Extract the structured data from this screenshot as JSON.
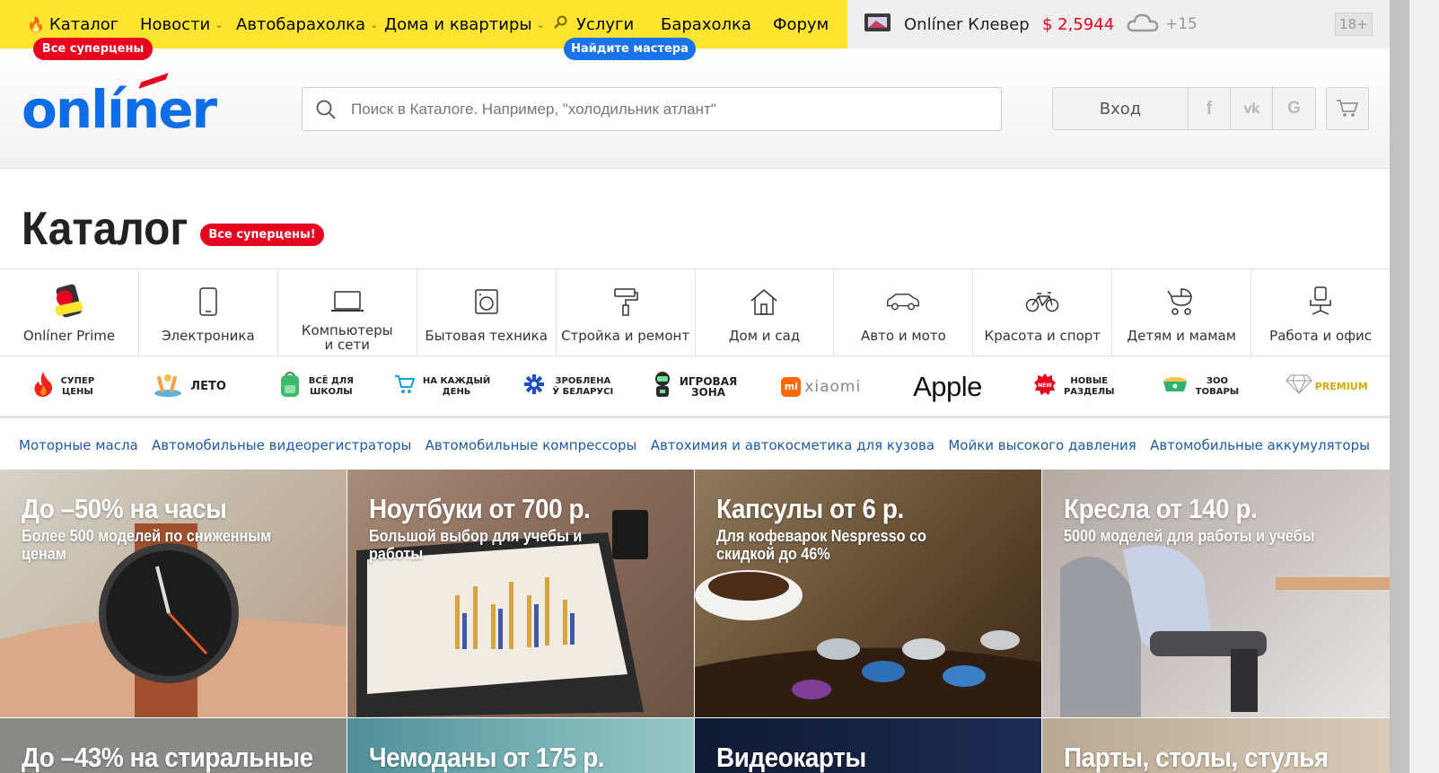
{
  "topnav": {
    "items": [
      {
        "label": "Каталог",
        "icon": "fire-icon"
      },
      {
        "label": "Новости"
      },
      {
        "label": "Автобарахолка"
      },
      {
        "label": "Дома и квартиры"
      },
      {
        "label": "Услуги",
        "icon": "magnifier-icon"
      },
      {
        "label": "Барахолка"
      },
      {
        "label": "Форум"
      }
    ],
    "badge_catalog": "Все суперцены",
    "badge_services": "Найдите мастера",
    "clever": "Onlíner Клевер",
    "rate": "$ 2,5944",
    "temperature": "+15",
    "age": "18+",
    "colors": {
      "yellow": "#ffe52f",
      "red": "#e8001f",
      "blue": "#1a73e8"
    }
  },
  "header": {
    "logo": "onlíner",
    "search_placeholder": "Поиск в Каталоге. Например, \"холодильник атлант\"",
    "login": "Вход",
    "social": [
      "f",
      "vk",
      "G"
    ]
  },
  "catalog": {
    "title": "Каталог",
    "badge": "Все суперцены!",
    "categories": [
      {
        "label": "Onlíner Prime",
        "icon": "prime-icon"
      },
      {
        "label": "Электроника",
        "icon": "smartphone-icon"
      },
      {
        "label": "Компьютеры\nи сети",
        "icon": "laptop-icon"
      },
      {
        "label": "Бытовая техника",
        "icon": "washing-machine-icon"
      },
      {
        "label": "Стройка и ремонт",
        "icon": "paint-roller-icon"
      },
      {
        "label": "Дом и сад",
        "icon": "house-icon"
      },
      {
        "label": "Авто и мото",
        "icon": "car-icon"
      },
      {
        "label": "Красота и спорт",
        "icon": "bicycle-icon"
      },
      {
        "label": "Детям и мамам",
        "icon": "stroller-icon"
      },
      {
        "label": "Работа и офис",
        "icon": "office-chair-icon"
      }
    ],
    "promos": [
      {
        "label": "СУПЕР\nЦЕНЫ",
        "icon": "fire-icon"
      },
      {
        "label": "ЛЕТО",
        "icon": "summer-icon"
      },
      {
        "label": "ВСЁ ДЛЯ\nШКОЛЫ",
        "icon": "backpack-icon"
      },
      {
        "label": "НА КАЖДЫЙ\nДЕНЬ",
        "icon": "shopping-cart-icon"
      },
      {
        "label": "ЗРОБЛЕНА\nЎ БЕЛАРУСІ",
        "icon": "ornament-icon"
      },
      {
        "label": "ИГРОВАЯ\nЗОНА",
        "icon": "gamer-icon"
      },
      {
        "label": "xiaomi",
        "icon": "xiaomi-logo"
      },
      {
        "label": "Apple",
        "icon": "apple-logo"
      },
      {
        "label": "НОВЫЕ\nРАЗДЕЛЫ",
        "icon": "new-badge-icon"
      },
      {
        "label": "ЗОО\nТОВАРЫ",
        "icon": "pet-bowl-icon"
      },
      {
        "label": "PREMIUM",
        "icon": "diamond-icon"
      }
    ],
    "quick_links": [
      "Моторные масла",
      "Автомобильные видеорегистраторы",
      "Автомобильные компрессоры",
      "Автохимия и автокосметика для кузова",
      "Мойки высокого давления",
      "Автомобильные аккумуляторы"
    ],
    "tiles": [
      {
        "title": "До –50% на часы",
        "subtitle": "Более 500 моделей по сниженным ценам"
      },
      {
        "title": "Ноутбуки от 700 р.",
        "subtitle": "Большой выбор для учебы и работы"
      },
      {
        "title": "Капсулы от 6 р.",
        "subtitle": "Для кофеварок Nespresso со скидкой до 46%"
      },
      {
        "title": "Кресла от 140 р.",
        "subtitle": "5000 моделей для работы и учебы"
      },
      {
        "title": "До –43% на стиральные",
        "subtitle": ""
      },
      {
        "title": "Чемоданы от 175 р.",
        "subtitle": ""
      },
      {
        "title": "Видеокарты",
        "subtitle": ""
      },
      {
        "title": "Парты, столы, стулья",
        "subtitle": ""
      }
    ]
  }
}
